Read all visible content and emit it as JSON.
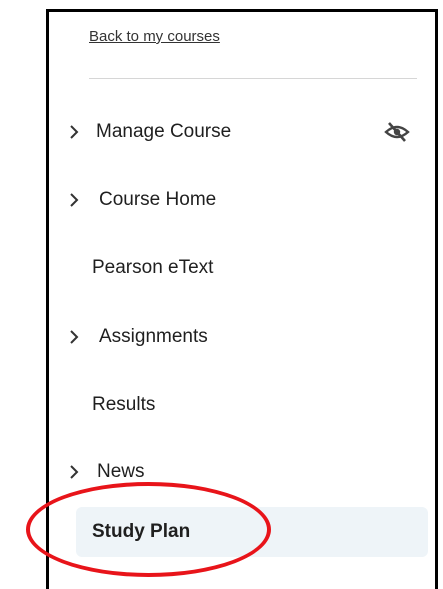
{
  "back_link": "Back to my courses",
  "nav": {
    "manage_course": "Manage Course",
    "course_home": "Course Home",
    "pearson_etext": "Pearson eText",
    "assignments": "Assignments",
    "results": "Results",
    "news": "News",
    "study_plan": "Study Plan"
  },
  "colors": {
    "highlight_circle": "#e8141a",
    "active_item_bg": "#eef4f8"
  },
  "icons": {
    "visibility": "eye-slash-icon",
    "expand": "chevron-right-icon"
  }
}
